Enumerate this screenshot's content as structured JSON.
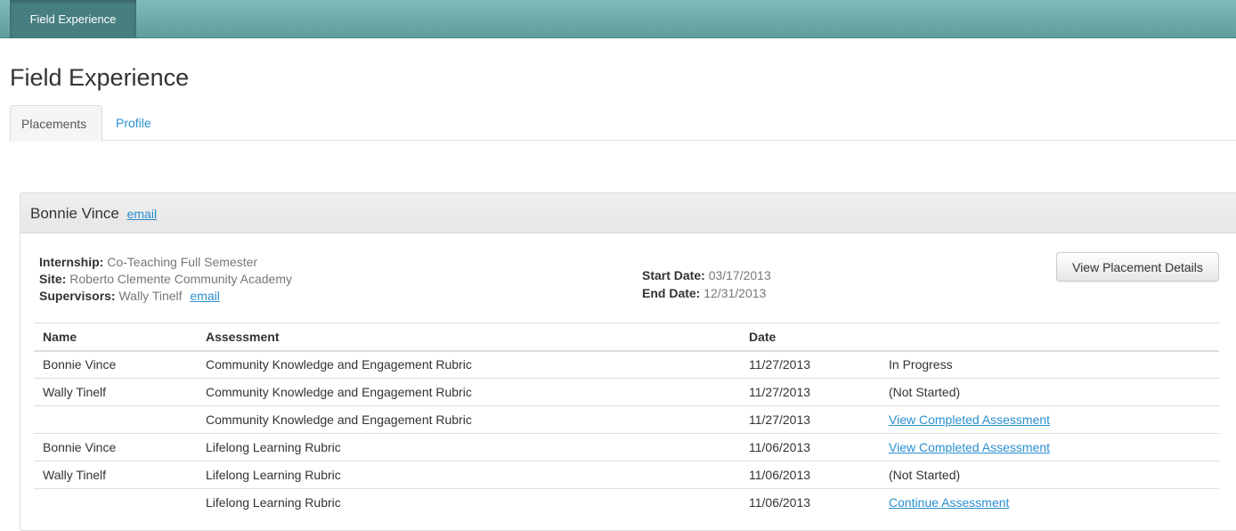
{
  "nav": {
    "active_item": "Field Experience"
  },
  "page": {
    "title": "Field Experience"
  },
  "tabs": [
    {
      "label": "Placements",
      "active": true
    },
    {
      "label": "Profile",
      "active": false
    }
  ],
  "placement": {
    "student_name": "Bonnie Vince",
    "student_email_label": "email",
    "internship_label": "Internship:",
    "internship": "Co-Teaching Full Semester",
    "site_label": "Site:",
    "site": "Roberto Clemente Community Academy",
    "supervisors_label": "Supervisors:",
    "supervisors": "Wally Tinelf",
    "supervisor_email_label": "email",
    "start_date_label": "Start Date:",
    "start_date": "03/17/2013",
    "end_date_label": "End Date:",
    "end_date": "12/31/2013",
    "details_button": "View Placement Details"
  },
  "table": {
    "headers": [
      "Name",
      "Assessment",
      "Date",
      ""
    ],
    "rows": [
      {
        "name": "Bonnie Vince",
        "assessment": "Community Knowledge and Engagement Rubric",
        "date": "11/27/2013",
        "status": "In Progress",
        "is_link": false
      },
      {
        "name": "Wally Tinelf",
        "assessment": "Community Knowledge and Engagement Rubric",
        "date": "11/27/2013",
        "status": "(Not Started)",
        "is_link": false
      },
      {
        "name": "",
        "assessment": "Community Knowledge and Engagement Rubric",
        "date": "11/27/2013",
        "status": "View Completed Assessment",
        "is_link": true
      },
      {
        "name": "Bonnie Vince",
        "assessment": "Lifelong Learning Rubric",
        "date": "11/06/2013",
        "status": "View Completed Assessment",
        "is_link": true
      },
      {
        "name": "Wally Tinelf",
        "assessment": "Lifelong Learning Rubric",
        "date": "11/06/2013",
        "status": "(Not Started)",
        "is_link": false
      },
      {
        "name": "",
        "assessment": "Lifelong Learning Rubric",
        "date": "11/06/2013",
        "status": "Continue Assessment",
        "is_link": true
      }
    ]
  },
  "colors": {
    "topbar": "#6aa8a9",
    "link": "#2a8fd1"
  }
}
